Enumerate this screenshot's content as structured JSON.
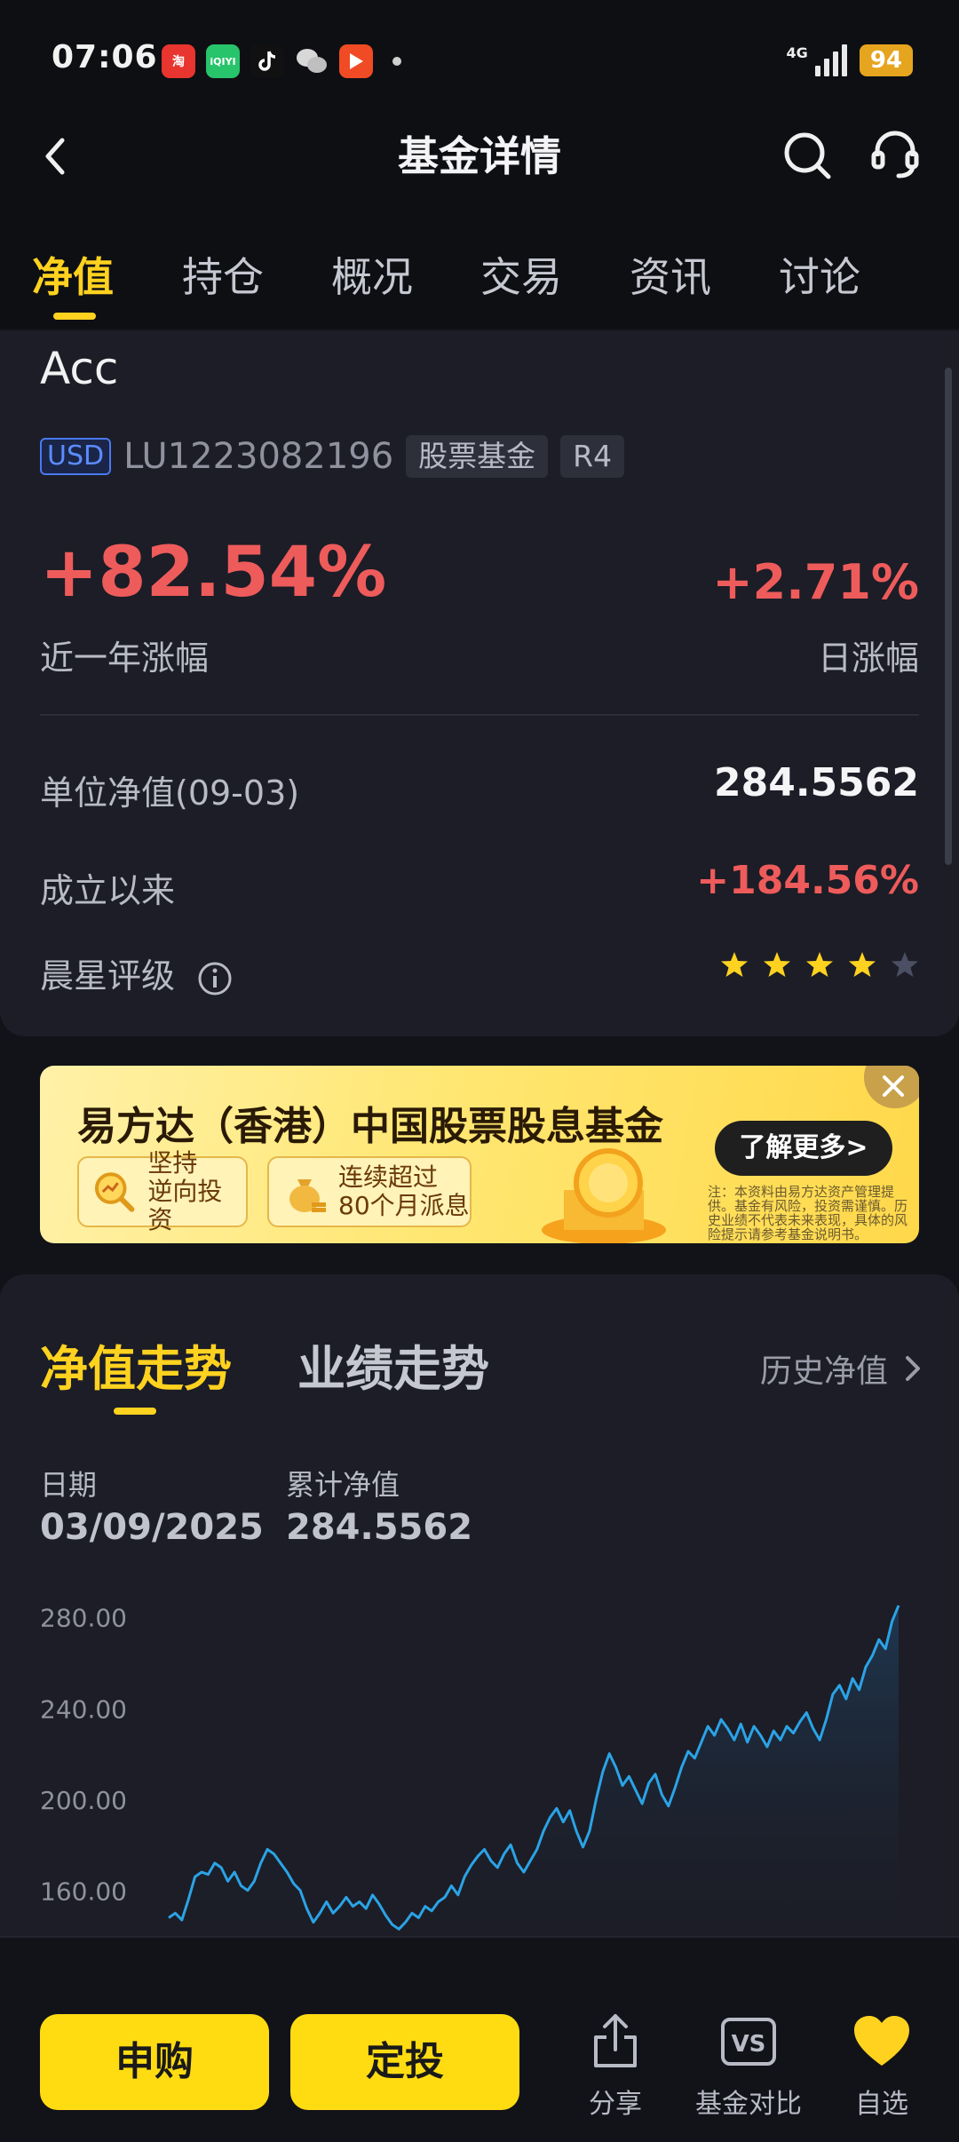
{
  "status_bar": {
    "time": "07:06",
    "network": "4G",
    "battery": "94"
  },
  "nav": {
    "title": "基金详情"
  },
  "tabs": [
    "净值",
    "持仓",
    "概况",
    "交易",
    "资讯",
    "讨论"
  ],
  "fund": {
    "share_class": "Acc",
    "currency": "USD",
    "code": "LU1223082196",
    "type": "股票基金",
    "risk": "R4",
    "year_change": "+82.54%",
    "year_change_label": "近一年涨幅",
    "day_change": "+2.71%",
    "day_change_label": "日涨幅",
    "nav_label": "单位净值(09-03)",
    "nav_value": "284.5562",
    "since_label": "成立以来",
    "since_value": "+184.56%",
    "rating_label": "晨星评级",
    "rating_stars": 4,
    "rating_max": 5
  },
  "banner": {
    "title": "易方达（香港）中国股票股息基金",
    "feature1": [
      "坚持",
      "逆向投资"
    ],
    "feature2": [
      "连续超过",
      "80个月派息"
    ],
    "button": "了解更多>",
    "note": "注：本资料由易方达资产管理提供。基金有风险，投资需谨慎。历史业绩不代表未来表现，具体的风险提示请参考基金说明书。"
  },
  "chart_section": {
    "tab_active": "净值走势",
    "tab_inactive": "业绩走势",
    "history_link": "历史净值",
    "date_label": "日期",
    "date_value": "03/09/2025",
    "cum_label": "累计净值",
    "cum_value": "284.5562"
  },
  "chart_data": {
    "type": "area",
    "title": "",
    "xlabel": "",
    "ylabel": "",
    "ylim": [
      140,
      290
    ],
    "yticks": [
      "280.00",
      "240.00",
      "200.00",
      "160.00"
    ],
    "color": "#2ba3e6",
    "values": [
      148,
      150,
      147,
      156,
      166,
      168,
      167,
      172,
      170,
      164,
      168,
      162,
      160,
      164,
      172,
      178,
      176,
      172,
      168,
      163,
      160,
      152,
      146,
      150,
      155,
      150,
      153,
      157,
      153,
      155,
      152,
      158,
      154,
      149,
      145,
      143,
      146,
      150,
      148,
      153,
      151,
      155,
      157,
      162,
      158,
      166,
      171,
      175,
      178,
      173,
      170,
      176,
      180,
      172,
      168,
      173,
      178,
      186,
      192,
      196,
      190,
      195,
      186,
      179,
      186,
      200,
      212,
      220,
      214,
      206,
      210,
      204,
      198,
      207,
      211,
      202,
      197,
      205,
      214,
      221,
      218,
      225,
      232,
      228,
      235,
      231,
      226,
      233,
      225,
      232,
      228,
      223,
      230,
      226,
      232,
      229,
      234,
      238,
      231,
      226,
      235,
      246,
      250,
      244,
      253,
      248,
      258,
      263,
      270,
      266,
      278,
      285
    ]
  },
  "bottom_bar": {
    "subscribe": "申购",
    "regular": "定投",
    "share": "分享",
    "compare": "基金对比",
    "watchlist": "自选"
  }
}
